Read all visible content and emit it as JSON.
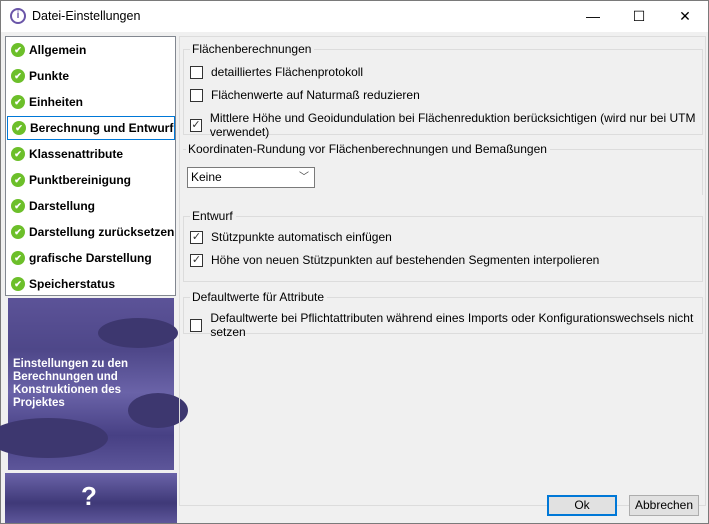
{
  "window": {
    "title": "Datei-Einstellungen",
    "minimize": "—",
    "maximize": "☐",
    "close": "✕"
  },
  "nav": {
    "items": [
      {
        "label": "Allgemein"
      },
      {
        "label": "Punkte"
      },
      {
        "label": "Einheiten"
      },
      {
        "label": "Berechnung und Entwurf",
        "selected": true
      },
      {
        "label": "Klassenattribute"
      },
      {
        "label": "Punktbereinigung"
      },
      {
        "label": "Darstellung"
      },
      {
        "label": "Darstellung zurücksetzen"
      },
      {
        "label": "grafische Darstellung"
      },
      {
        "label": "Speicherstatus"
      }
    ]
  },
  "info_panel": {
    "text": "Einstellungen zu den Berechnungen und Konstruktionen des Projektes",
    "help": "?"
  },
  "groups": {
    "flaechen": {
      "title": "Flächenberechnungen",
      "options": [
        {
          "label": "detailliertes Flächenprotokoll",
          "checked": false
        },
        {
          "label": "Flächenwerte auf Naturmaß reduzieren",
          "checked": false
        },
        {
          "label": "Mittlere Höhe und Geoidundulation bei Flächenreduktion berücksichtigen (wird nur bei UTM verwendet)",
          "checked": true
        }
      ]
    },
    "rundung": {
      "title": "Koordinaten-Rundung vor Flächenberechnungen und Bemaßungen",
      "value": "Keine"
    },
    "entwurf": {
      "title": "Entwurf",
      "options": [
        {
          "label": "Stützpunkte automatisch einfügen",
          "checked": true
        },
        {
          "label": "Höhe von neuen Stützpunkten auf bestehenden Segmenten interpolieren",
          "checked": true
        }
      ]
    },
    "default": {
      "title": "Defaultwerte für Attribute",
      "options": [
        {
          "label": "Defaultwerte bei Pflichtattributen während eines Imports oder Konfigurationswechsels nicht setzen",
          "checked": false
        }
      ]
    }
  },
  "buttons": {
    "ok": "Ok",
    "cancel": "Abbrechen"
  }
}
